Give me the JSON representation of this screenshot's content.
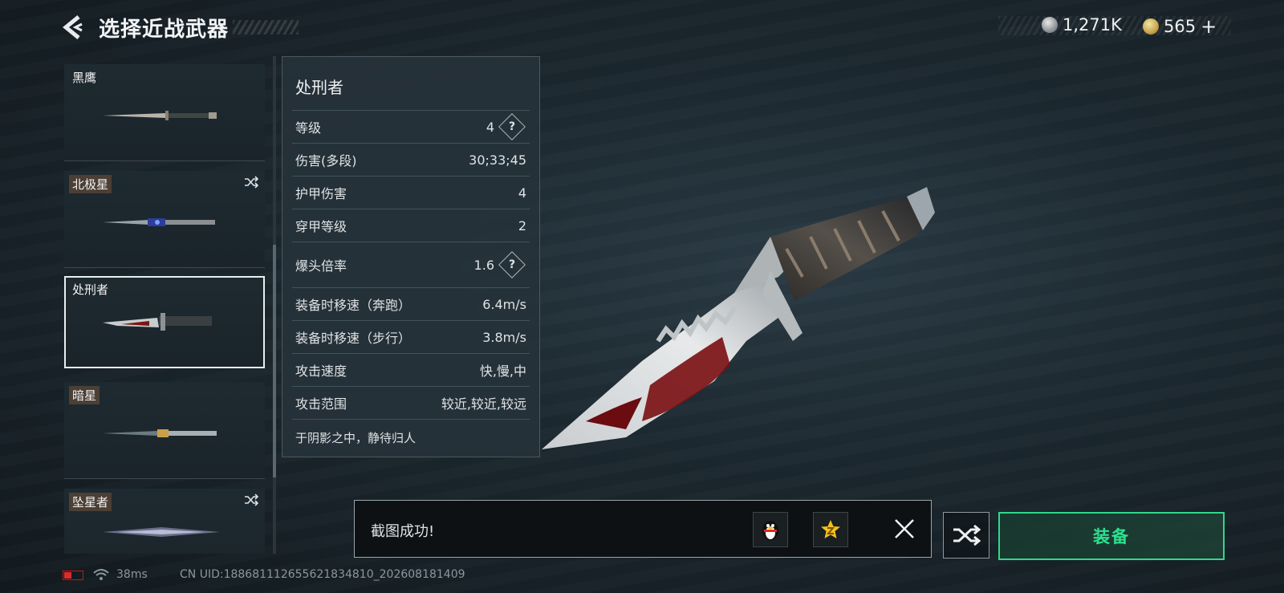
{
  "header": {
    "title": "选择近战武器"
  },
  "currency": {
    "silver": "1,271K",
    "gold": "565",
    "gold_plus": "+"
  },
  "weapons": [
    {
      "label": "黑鹰",
      "tagged": false,
      "random_icon": false
    },
    {
      "label": "北极星",
      "tagged": true,
      "random_icon": true
    },
    {
      "label": "处刑者",
      "tagged": false,
      "random_icon": false,
      "selected": true
    },
    {
      "label": "暗星",
      "tagged": true,
      "random_icon": false
    },
    {
      "label": "坠星者",
      "tagged": true,
      "random_icon": true
    }
  ],
  "stats": {
    "name": "处刑者",
    "rows": [
      {
        "label": "等级",
        "value": "4",
        "help": true
      },
      {
        "label": "伤害(多段)",
        "value": "30;33;45"
      },
      {
        "label": "护甲伤害",
        "value": "4"
      },
      {
        "label": "穿甲等级",
        "value": "2"
      },
      {
        "label": "爆头倍率",
        "value": "1.6",
        "help": true
      },
      {
        "label": "装备时移速（奔跑）",
        "value": "6.4m/s"
      },
      {
        "label": "装备时移速（步行）",
        "value": "3.8m/s"
      },
      {
        "label": "攻击速度",
        "value": "快,慢,中"
      },
      {
        "label": "攻击范围",
        "value": "较近,较近,较远"
      }
    ],
    "description": "于阴影之中，静待归人",
    "help_symbol": "?"
  },
  "toast": {
    "message": "截图成功!"
  },
  "buttons": {
    "equip": "装备"
  },
  "status": {
    "ping": "38ms",
    "uid": "CN UID:18868111265562183481​0_202608181409"
  },
  "colors": {
    "accent_green": "#2ee08f",
    "battery_red": "#e02a2a"
  }
}
